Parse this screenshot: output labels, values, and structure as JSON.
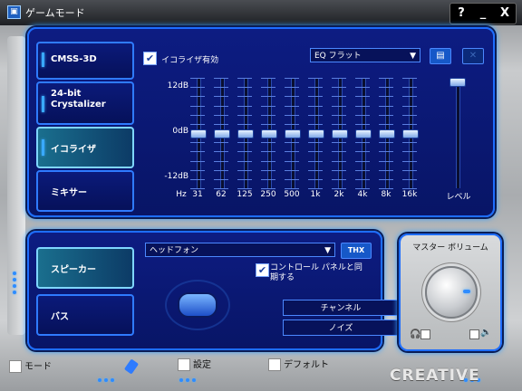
{
  "window": {
    "title": "ゲームモード",
    "help_label": "?",
    "minimize_label": "_",
    "close_label": "X"
  },
  "tabs": [
    {
      "label": "CMSS-3D",
      "active": false
    },
    {
      "label": "24-bit Crystalizer",
      "active": false
    },
    {
      "label": "イコライザ",
      "active": true
    },
    {
      "label": "ミキサー",
      "active": false
    }
  ],
  "equalizer": {
    "enable_label": "イコライザ有効",
    "enabled": true,
    "preset": "EQ フラット",
    "db_labels": [
      "12dB",
      "0dB",
      "-12dB"
    ],
    "hz_label": "Hz",
    "level_label": "レベル",
    "bands": [
      {
        "freq": "31",
        "gain_db": 0
      },
      {
        "freq": "62",
        "gain_db": 0
      },
      {
        "freq": "125",
        "gain_db": 0
      },
      {
        "freq": "250",
        "gain_db": 0
      },
      {
        "freq": "500",
        "gain_db": 0
      },
      {
        "freq": "1k",
        "gain_db": 0
      },
      {
        "freq": "2k",
        "gain_db": 0
      },
      {
        "freq": "4k",
        "gain_db": 0
      },
      {
        "freq": "8k",
        "gain_db": 0
      },
      {
        "freq": "16k",
        "gain_db": 0
      }
    ],
    "level_fraction": 1.0
  },
  "mixer_tabs": [
    {
      "label": "スピーカー",
      "active": true
    },
    {
      "label": "バス",
      "active": false
    }
  ],
  "speaker": {
    "output": "ヘッドフォン",
    "thx_label": "THX",
    "sync_label": "コントロール パネルと同期する",
    "sync_checked": true,
    "channel_label": "チャンネル",
    "noise_label": "ノイズ"
  },
  "master_volume": {
    "title": "マスター ボリューム"
  },
  "bottom": {
    "mode_label": "モード",
    "settings_label": "設定",
    "default_label": "デフォルト"
  },
  "brand": "CREATIVE"
}
